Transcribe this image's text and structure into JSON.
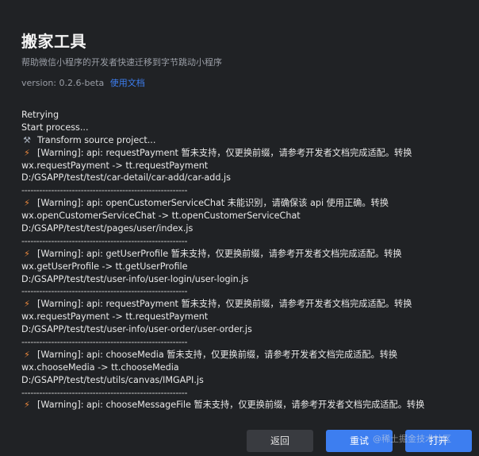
{
  "header": {
    "title": "搬家工具",
    "subtitle": "帮助微信小程序的开发者快速迁移到字节跳动小程序",
    "version_text": "version: 0.2.6-beta",
    "doc_link": "使用文档"
  },
  "log": {
    "lines": [
      {
        "kind": "text",
        "text": "Retrying"
      },
      {
        "kind": "text",
        "text": "Start process..."
      },
      {
        "kind": "tool",
        "text": "Transform source project..."
      },
      {
        "kind": "warn",
        "text": "[Warning]: api: requestPayment 暂未支持，仅更换前缀，请参考开发者文档完成适配。转换"
      },
      {
        "kind": "text",
        "text": "wx.requestPayment -> tt.requestPayment"
      },
      {
        "kind": "text",
        "text": "D:/GSAPP/test/test/car-detail/car-add/car-add.js"
      },
      {
        "kind": "sep",
        "text": "--------------------------------------------------------"
      },
      {
        "kind": "warn",
        "text": "[Warning]: api: openCustomerServiceChat 未能识别，请确保该 api 使用正确。转换"
      },
      {
        "kind": "text",
        "text": "wx.openCustomerServiceChat -> tt.openCustomerServiceChat"
      },
      {
        "kind": "text",
        "text": "D:/GSAPP/test/test/pages/user/index.js"
      },
      {
        "kind": "sep",
        "text": "--------------------------------------------------------"
      },
      {
        "kind": "warn",
        "text": "[Warning]: api: getUserProfile 暂未支持，仅更换前缀，请参考开发者文档完成适配。转换"
      },
      {
        "kind": "text",
        "text": "wx.getUserProfile -> tt.getUserProfile"
      },
      {
        "kind": "text",
        "text": "D:/GSAPP/test/test/user-info/user-login/user-login.js"
      },
      {
        "kind": "sep",
        "text": "--------------------------------------------------------"
      },
      {
        "kind": "warn",
        "text": "[Warning]: api: requestPayment 暂未支持，仅更换前缀，请参考开发者文档完成适配。转换"
      },
      {
        "kind": "text",
        "text": "wx.requestPayment -> tt.requestPayment"
      },
      {
        "kind": "text",
        "text": "D:/GSAPP/test/test/user-info/user-order/user-order.js"
      },
      {
        "kind": "sep",
        "text": "--------------------------------------------------------"
      },
      {
        "kind": "warn",
        "text": "[Warning]: api: chooseMedia 暂未支持，仅更换前缀，请参考开发者文档完成适配。转换"
      },
      {
        "kind": "text",
        "text": "wx.chooseMedia -> tt.chooseMedia"
      },
      {
        "kind": "text",
        "text": "D:/GSAPP/test/test/utils/canvas/IMGAPI.js"
      },
      {
        "kind": "sep",
        "text": "--------------------------------------------------------"
      },
      {
        "kind": "warn",
        "text": "[Warning]: api: chooseMessageFile 暂未支持，仅更换前缀，请参考开发者文档完成适配。转换"
      }
    ]
  },
  "icons": {
    "warning": "lightning-icon",
    "tool": "wrench-icon"
  },
  "buttons": {
    "back": "返回",
    "retry": "重试",
    "open": "打开"
  },
  "watermark": "@稀土掘金技术社区",
  "colors": {
    "background": "#202225",
    "accent": "#3d7ef0",
    "warning_icon": "#f08a3c",
    "secondary_button": "#393b40"
  }
}
